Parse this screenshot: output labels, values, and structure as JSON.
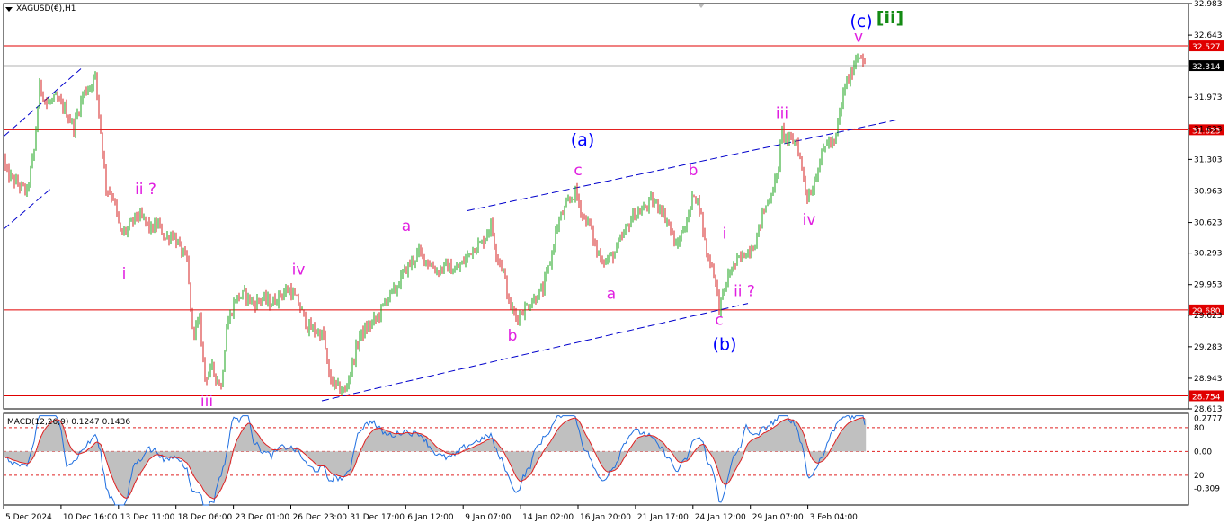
{
  "window": {
    "symbol_title": "XAGUSD(€),H1",
    "indicator_title": "MACD(12,26,9) 0.1247 0.1436"
  },
  "colors": {
    "bull_candle": "#19a319",
    "bear_candle": "#d42020",
    "hline": "#e00000",
    "current_line": "#b0b0b0",
    "channel": "#0000cc",
    "wave_pink": "#e01ee0",
    "wave_blue": "#0000ff",
    "wave_green": "#138a13",
    "macd_hist": "#c0c0c0",
    "macd_line": "#1e6ee0",
    "signal_line": "#e02020",
    "macd_level": "#e02020"
  },
  "chart_data": {
    "type": "candlestick",
    "symbol": "XAGUSD(€)",
    "timeframe": "H1",
    "ylim": [
      28.613,
      32.983
    ],
    "y_ticks": [
      "32.983",
      "32.643",
      "31.973",
      "31.633",
      "31.303",
      "30.963",
      "30.623",
      "30.293",
      "29.953",
      "29.623",
      "29.283",
      "28.943",
      "28.613"
    ],
    "x_ticks": [
      "5 Dec 2024",
      "10 Dec 16:00",
      "13 Dec 11:00",
      "18 Dec 06:00",
      "23 Dec 01:00",
      "26 Dec 23:00",
      "31 Dec 17:00",
      "6 Jan 12:00",
      "9 Jan 07:00",
      "14 Jan 02:00",
      "16 Jan 20:00",
      "21 Jan 17:00",
      "24 Jan 12:00",
      "29 Jan 07:00",
      "3 Feb 04:00"
    ],
    "price_path": [
      [
        0,
        31.35
      ],
      [
        8,
        31.15
      ],
      [
        18,
        31.05
      ],
      [
        30,
        30.95
      ],
      [
        38,
        31.4
      ],
      [
        44,
        32.1
      ],
      [
        52,
        31.9
      ],
      [
        62,
        31.95
      ],
      [
        72,
        31.85
      ],
      [
        82,
        31.65
      ],
      [
        92,
        32.0
      ],
      [
        100,
        32.1
      ],
      [
        106,
        32.2
      ],
      [
        112,
        31.6
      ],
      [
        118,
        31.0
      ],
      [
        126,
        30.9
      ],
      [
        134,
        30.5
      ],
      [
        142,
        30.55
      ],
      [
        152,
        30.7
      ],
      [
        160,
        30.65
      ],
      [
        168,
        30.55
      ],
      [
        176,
        30.6
      ],
      [
        184,
        30.45
      ],
      [
        192,
        30.5
      ],
      [
        200,
        30.35
      ],
      [
        208,
        30.2
      ],
      [
        214,
        29.45
      ],
      [
        222,
        29.55
      ],
      [
        228,
        28.95
      ],
      [
        236,
        29.05
      ],
      [
        246,
        28.85
      ],
      [
        252,
        29.5
      ],
      [
        262,
        29.8
      ],
      [
        272,
        29.85
      ],
      [
        282,
        29.75
      ],
      [
        292,
        29.8
      ],
      [
        302,
        29.75
      ],
      [
        312,
        29.85
      ],
      [
        322,
        29.9
      ],
      [
        332,
        29.75
      ],
      [
        342,
        29.5
      ],
      [
        352,
        29.45
      ],
      [
        360,
        29.4
      ],
      [
        366,
        28.95
      ],
      [
        374,
        28.85
      ],
      [
        384,
        28.8
      ],
      [
        392,
        29.1
      ],
      [
        400,
        29.4
      ],
      [
        410,
        29.5
      ],
      [
        420,
        29.6
      ],
      [
        430,
        29.8
      ],
      [
        440,
        29.9
      ],
      [
        450,
        30.1
      ],
      [
        458,
        30.2
      ],
      [
        466,
        30.3
      ],
      [
        476,
        30.2
      ],
      [
        486,
        30.1
      ],
      [
        496,
        30.15
      ],
      [
        506,
        30.1
      ],
      [
        516,
        30.2
      ],
      [
        526,
        30.35
      ],
      [
        536,
        30.4
      ],
      [
        546,
        30.6
      ],
      [
        552,
        30.3
      ],
      [
        560,
        30.1
      ],
      [
        566,
        29.75
      ],
      [
        574,
        29.6
      ],
      [
        584,
        29.7
      ],
      [
        594,
        29.8
      ],
      [
        604,
        29.9
      ],
      [
        612,
        30.2
      ],
      [
        620,
        30.6
      ],
      [
        630,
        30.8
      ],
      [
        640,
        30.95
      ],
      [
        648,
        30.7
      ],
      [
        656,
        30.6
      ],
      [
        664,
        30.3
      ],
      [
        674,
        30.2
      ],
      [
        684,
        30.3
      ],
      [
        694,
        30.5
      ],
      [
        704,
        30.7
      ],
      [
        714,
        30.75
      ],
      [
        724,
        30.85
      ],
      [
        734,
        30.8
      ],
      [
        744,
        30.6
      ],
      [
        752,
        30.35
      ],
      [
        760,
        30.55
      ],
      [
        766,
        30.7
      ],
      [
        772,
        30.95
      ],
      [
        778,
        30.8
      ],
      [
        786,
        30.3
      ],
      [
        794,
        30.1
      ],
      [
        800,
        29.7
      ],
      [
        806,
        29.9
      ],
      [
        812,
        30.1
      ],
      [
        820,
        30.2
      ],
      [
        830,
        30.3
      ],
      [
        840,
        30.4
      ],
      [
        848,
        30.7
      ],
      [
        856,
        30.9
      ],
      [
        864,
        31.1
      ],
      [
        870,
        31.6
      ],
      [
        878,
        31.5
      ],
      [
        886,
        31.5
      ],
      [
        892,
        31.2
      ],
      [
        898,
        30.9
      ],
      [
        904,
        31.0
      ],
      [
        912,
        31.3
      ],
      [
        920,
        31.5
      ],
      [
        928,
        31.45
      ],
      [
        934,
        31.8
      ],
      [
        940,
        32.1
      ],
      [
        946,
        32.2
      ],
      [
        952,
        32.4
      ],
      [
        958,
        32.45
      ],
      [
        962,
        32.3
      ]
    ],
    "horizontal_levels": [
      {
        "label": "32.527",
        "highlight": true
      },
      {
        "label": "32.314",
        "highlight": false
      },
      {
        "label": "31.623",
        "highlight": true
      },
      {
        "label": "29.680",
        "highlight": true
      },
      {
        "label": "28.754",
        "highlight": true
      }
    ],
    "wave_labels": [
      {
        "text": "(c)",
        "price": 32.73,
        "color": "blue",
        "xi": 958
      },
      {
        "text": "[ii]",
        "price": 32.77,
        "color": "green",
        "xi": 990
      },
      {
        "text": "v",
        "price": 32.57,
        "color": "pink",
        "xi": 955
      },
      {
        "text": "iii",
        "price": 31.75,
        "color": "pink",
        "xi": 870
      },
      {
        "text": "iv",
        "price": 30.6,
        "color": "pink",
        "xi": 900
      },
      {
        "text": "(a)",
        "price": 31.45,
        "color": "blue",
        "xi": 648
      },
      {
        "text": "c",
        "price": 31.13,
        "color": "pink",
        "xi": 643
      },
      {
        "text": "b",
        "price": 31.13,
        "color": "pink",
        "xi": 771
      },
      {
        "text": "i",
        "price": 30.45,
        "color": "pink",
        "xi": 806
      },
      {
        "text": "ii ?",
        "price": 29.83,
        "color": "pink",
        "xi": 828
      },
      {
        "text": "c",
        "price": 29.52,
        "color": "pink",
        "xi": 800
      },
      {
        "text": "(b)",
        "price": 29.25,
        "color": "blue",
        "xi": 806
      },
      {
        "text": "a",
        "price": 30.53,
        "color": "pink",
        "xi": 452
      },
      {
        "text": "a",
        "price": 29.8,
        "color": "pink",
        "xi": 680
      },
      {
        "text": "b",
        "price": 29.35,
        "color": "pink",
        "xi": 570
      },
      {
        "text": "ii ?",
        "price": 30.93,
        "color": "pink",
        "xi": 162
      },
      {
        "text": "i",
        "price": 30.02,
        "color": "pink",
        "xi": 138
      },
      {
        "text": "iv",
        "price": 30.06,
        "color": "pink",
        "xi": 332
      },
      {
        "text": "iii",
        "price": 28.64,
        "color": "pink",
        "xi": 230
      }
    ],
    "channels": [
      {
        "from": [
          4,
          31.55
        ],
        "to": [
          90,
          32.28
        ]
      },
      {
        "from": [
          4,
          30.55
        ],
        "to": [
          58,
          31.0
        ]
      },
      {
        "from": [
          520,
          30.75
        ],
        "to": [
          998,
          31.73
        ]
      },
      {
        "from": [
          358,
          28.7
        ],
        "to": [
          832,
          29.75
        ]
      }
    ],
    "macd": {
      "ylim": [
        -0.45,
        0.32
      ],
      "y_ticks": [
        "0.2777",
        "80",
        "0.00",
        "20",
        "-0.309"
      ],
      "current_macd": 0.1247,
      "current_signal": 0.1436,
      "levels": [
        0.2,
        0.0,
        -0.2
      ]
    }
  }
}
